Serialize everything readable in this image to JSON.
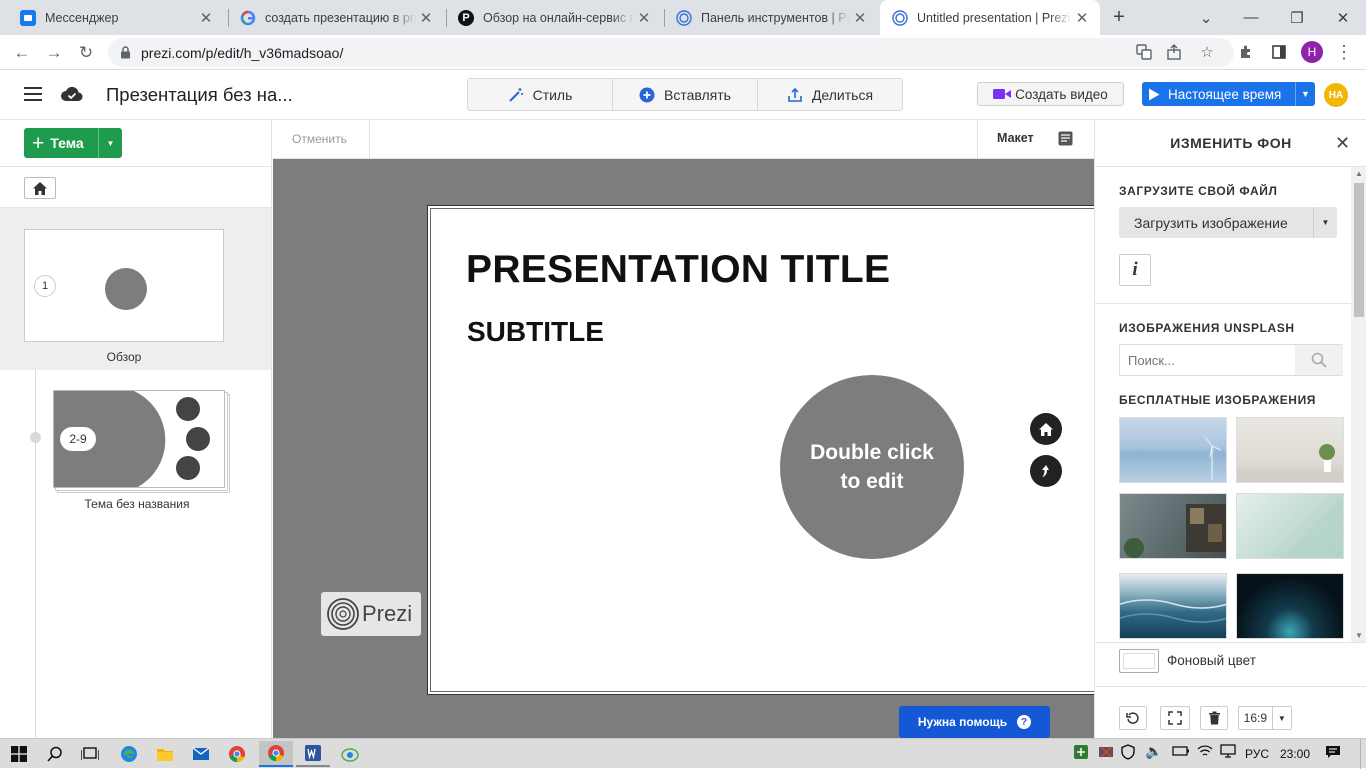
{
  "browser": {
    "tabs": [
      {
        "title": "Мессенджер",
        "favicon": "messenger-icon",
        "active": false
      },
      {
        "title": "создать презентацию в prezi",
        "favicon": "google-icon",
        "active": false
      },
      {
        "title": "Обзор на онлайн-сервис по",
        "favicon": "p-logo-icon",
        "active": false
      },
      {
        "title": "Панель инструментов | Prezi",
        "favicon": "prezi-icon",
        "active": false
      },
      {
        "title": "Untitled presentation | Prezi",
        "favicon": "prezi-icon",
        "active": true
      }
    ],
    "url": "prezi.com/p/edit/h_v36madsoao/",
    "profile_initial": "Н"
  },
  "header": {
    "presentation_title": "Презентация без на...",
    "style_label": "Стиль",
    "insert_label": "Вставлять",
    "share_label": "Делиться",
    "create_video_label": "Создать видео",
    "present_label": "Настоящее время",
    "user_initials": "НА",
    "accent_green": "#1a9b4c",
    "accent_blue": "#1a73e8"
  },
  "left": {
    "topic_label": "Тема",
    "overview_number": "1",
    "overview_label": "Обзор",
    "topic_range": "2-9",
    "topic_name": "Тема без названия"
  },
  "canvas": {
    "undo_label": "Отменить",
    "layout_label": "Макет",
    "slide_title": "PRESENTATION TITLE",
    "slide_subtitle": "SUBTITLE",
    "circle_text_line1": "Double click",
    "circle_text_line2": "to edit",
    "prezi_watermark": "Prezi",
    "help_label": "Нужна помощь"
  },
  "right": {
    "title": "ИЗМЕНИТЬ ФОН",
    "upload_section": "ЗАГРУЗИТЕ СВОЙ ФАЙЛ",
    "upload_button": "Загрузить изображение",
    "unsplash_section": "ИЗОБРАЖЕНИЯ UNSPLASH",
    "search_placeholder": "Поиск...",
    "free_images_section": "БЕСПЛАТНЫЕ ИЗОБРАЖЕНИЯ",
    "bg_color_label": "Фоновый цвет",
    "aspect_ratio": "16:9"
  },
  "taskbar": {
    "language": "РУС",
    "time": "23:00"
  }
}
